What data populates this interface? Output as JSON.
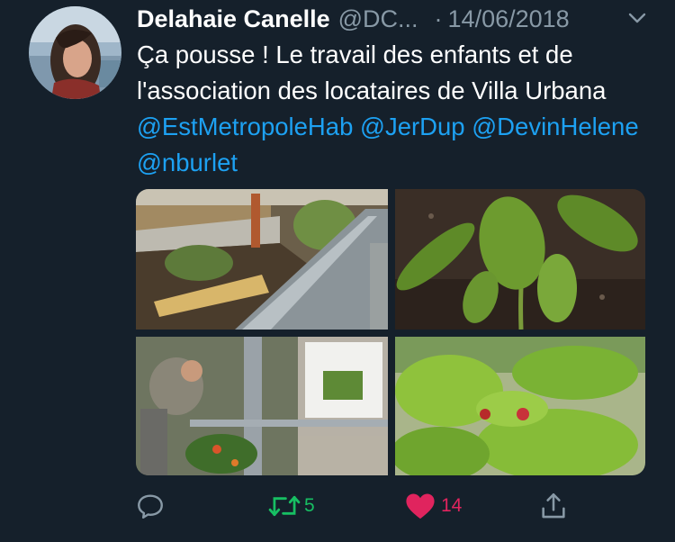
{
  "tweet": {
    "author_name": "Delahaie Canelle",
    "author_handle": "@DC...",
    "separator": "·",
    "date": "14/06/2018",
    "text_plain": "Ça pousse ! Le travail des enfants et de l'association des locataires de Villa Urbana",
    "mentions": [
      "@EstMetropoleHab",
      "@JerDup",
      "@DevinHelene",
      "@nburlet"
    ]
  },
  "media": {
    "photos": [
      {
        "icon": "garden-planter-photo"
      },
      {
        "icon": "pepper-plant-photo"
      },
      {
        "icon": "gardener-photo"
      },
      {
        "icon": "raspberry-plant-photo"
      }
    ]
  },
  "actions": {
    "reply": {
      "icon": "reply-icon"
    },
    "retweet": {
      "icon": "retweet-icon",
      "count": "5",
      "color": "#17bf63"
    },
    "like": {
      "icon": "heart-icon",
      "count": "14",
      "color": "#e0245e"
    },
    "share": {
      "icon": "share-icon"
    }
  },
  "colors": {
    "background": "#15202b",
    "link": "#1da1f2",
    "secondary_text": "#8899a6"
  }
}
